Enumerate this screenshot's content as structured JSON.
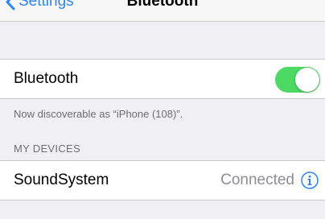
{
  "navbar": {
    "back_label": "Settings",
    "title": "Bluetooth"
  },
  "bluetooth": {
    "label": "Bluetooth",
    "enabled": true,
    "discoverable_note": "Now discoverable as “iPhone (108)”."
  },
  "my_devices": {
    "header": "MY DEVICES",
    "items": [
      {
        "name": "SoundSystem",
        "status": "Connected",
        "icon": "info-icon"
      }
    ]
  },
  "colors": {
    "accent": "#2c86f5",
    "toggle_on": "#4cd964",
    "background": "#efeff4",
    "secondary_text": "#8e8e93"
  }
}
